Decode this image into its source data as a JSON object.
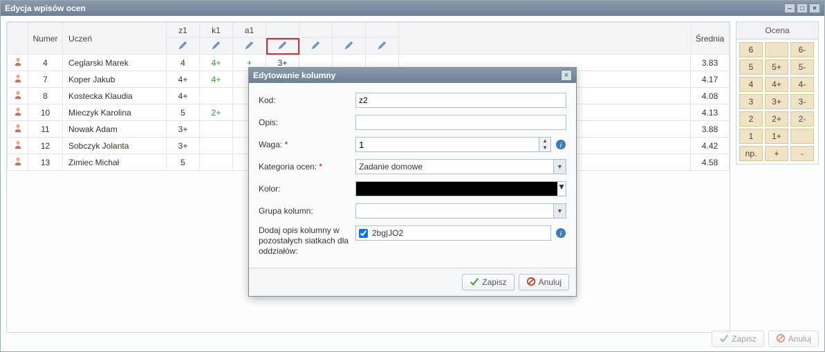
{
  "window": {
    "title": "Edycja wpisów ocen"
  },
  "table": {
    "headers": {
      "numer": "Numer",
      "uczen": "Uczeń",
      "srednia": "Średnia"
    },
    "grade_cols": [
      "z1",
      "k1",
      "a1",
      "",
      "",
      "",
      ""
    ],
    "rows": [
      {
        "n": "4",
        "name": "Ceglarski Marek",
        "grades": [
          "4",
          "4+",
          "+",
          "3+",
          "",
          "",
          ""
        ],
        "avg": "3.83"
      },
      {
        "n": "7",
        "name": "Koper Jakub",
        "grades": [
          "4+",
          "4+",
          "",
          "",
          "",
          "",
          ""
        ],
        "avg": "4.17"
      },
      {
        "n": "8",
        "name": "Kostecka Klaudia",
        "grades": [
          "4+",
          "",
          "",
          "",
          "",
          "",
          ""
        ],
        "avg": "4.08"
      },
      {
        "n": "10",
        "name": "Mieczyk Karolina",
        "grades": [
          "5",
          "2+",
          "",
          "",
          "",
          "",
          ""
        ],
        "avg": "4.13"
      },
      {
        "n": "11",
        "name": "Nowak Adam",
        "grades": [
          "3+",
          "",
          "",
          "",
          "",
          "",
          ""
        ],
        "avg": "3.88"
      },
      {
        "n": "12",
        "name": "Sobczyk Jolanta",
        "grades": [
          "3+",
          "",
          "",
          "",
          "",
          "",
          ""
        ],
        "avg": "4.42"
      },
      {
        "n": "13",
        "name": "Zimiec Michał",
        "grades": [
          "5",
          "",
          "",
          "",
          "",
          "",
          ""
        ],
        "avg": "4.58"
      }
    ]
  },
  "side": {
    "title": "Ocena",
    "rows": [
      [
        "6",
        "",
        "6-"
      ],
      [
        "5",
        "5+",
        "5-"
      ],
      [
        "4",
        "4+",
        "4-"
      ],
      [
        "3",
        "3+",
        "3-"
      ],
      [
        "2",
        "2+",
        "2-"
      ],
      [
        "1",
        "1+",
        ""
      ],
      [
        "np.",
        "+",
        "-"
      ]
    ]
  },
  "dialog": {
    "title": "Edytowanie kolumny",
    "labels": {
      "kod": "Kod:",
      "opis": "Opis:",
      "waga": "Waga:",
      "kategoria": "Kategoria ocen:",
      "kolor": "Kolor:",
      "grupa": "Grupa kolumn:",
      "dodaj": "Dodaj opis kolumny w pozostałych siatkach dla oddziałów:"
    },
    "values": {
      "kod": "z2",
      "opis": "",
      "waga": "1",
      "kategoria": "Zadanie domowe",
      "kolor": "#000000",
      "grupa": "",
      "dodaj_checked": true,
      "dodaj_text": "2bg|JO2"
    },
    "buttons": {
      "save": "Zapisz",
      "cancel": "Anuluj"
    }
  },
  "footer": {
    "save": "Zapisz",
    "cancel": "Anuluj"
  }
}
